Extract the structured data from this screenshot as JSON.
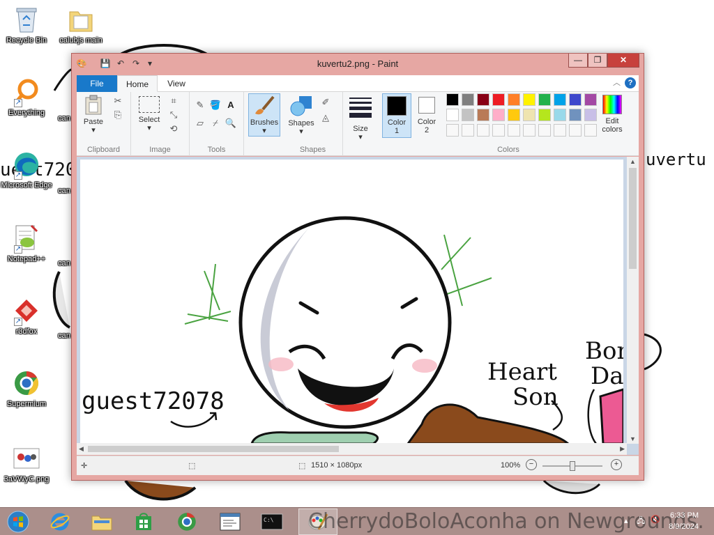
{
  "desktop_icons": [
    {
      "label": "Recycle Bin",
      "icon": "recycle-bin-icon"
    },
    {
      "label": "calubjs main",
      "icon": "folder-icon"
    },
    {
      "label": "Everything",
      "icon": "everything-search-icon"
    },
    {
      "label": "Microsoft Edge",
      "icon": "edge-icon"
    },
    {
      "label": "Notepad++",
      "icon": "notepad-plus-plus-icon"
    },
    {
      "label": "r3dfox",
      "icon": "r3dfox-icon"
    },
    {
      "label": "Supermium",
      "icon": "supermium-icon"
    },
    {
      "label": "3aVWyC.png",
      "icon": "image-file-icon"
    }
  ],
  "partial_icon_labels": [
    "can",
    "can",
    "can",
    "can",
    "can"
  ],
  "paint": {
    "title": "kuvertu2.png - Paint",
    "tabs": {
      "file": "File",
      "home": "Home",
      "view": "View"
    },
    "help": "?",
    "groups": {
      "clipboard": "Clipboard",
      "image": "Image",
      "tools": "Tools",
      "shapes": "Shapes",
      "colors": "Colors"
    },
    "buttons": {
      "paste": "Paste",
      "select": "Select",
      "brushes": "Brushes",
      "shapes": "Shapes",
      "size": "Size",
      "color1_l1": "Color",
      "color1_l2": "1",
      "color2_l1": "Color",
      "color2_l2": "2",
      "edit_colors_l1": "Edit",
      "edit_colors_l2": "colors",
      "text_tool": "A"
    },
    "color1": "#000000",
    "color2": "#ffffff",
    "palette_row1": [
      "#000000",
      "#7f7f7f",
      "#880015",
      "#ed1c24",
      "#ff7f27",
      "#fff200",
      "#22b14c",
      "#00a2e8",
      "#3f48cc",
      "#a349a4"
    ],
    "palette_row2": [
      "#ffffff",
      "#c3c3c3",
      "#b97a57",
      "#ffaec9",
      "#ffc90e",
      "#efe4b0",
      "#b5e61d",
      "#99d9ea",
      "#7092be",
      "#c8bfe7"
    ],
    "status": {
      "dimensions": "1510 × 1080px",
      "zoom": "100%"
    },
    "canvas_text": {
      "username": "guest72078",
      "heart_l1": "Heart",
      "heart_l2": "Son",
      "bon_l1": "Bon",
      "bon_l2": "Da"
    }
  },
  "wallpaper_text": {
    "username_left": "uest72078",
    "kuvertu": "uvertu"
  },
  "taskbar": {
    "items": [
      "internet-explorer-icon",
      "file-explorer-icon",
      "store-icon",
      "supermium-icon",
      "notepad-icon",
      "command-prompt-icon",
      "paint-icon"
    ],
    "watermark": "CherrydoBoloAconha on Newgrounds.",
    "time": "6:33 PM",
    "date": "8/9/2024"
  }
}
